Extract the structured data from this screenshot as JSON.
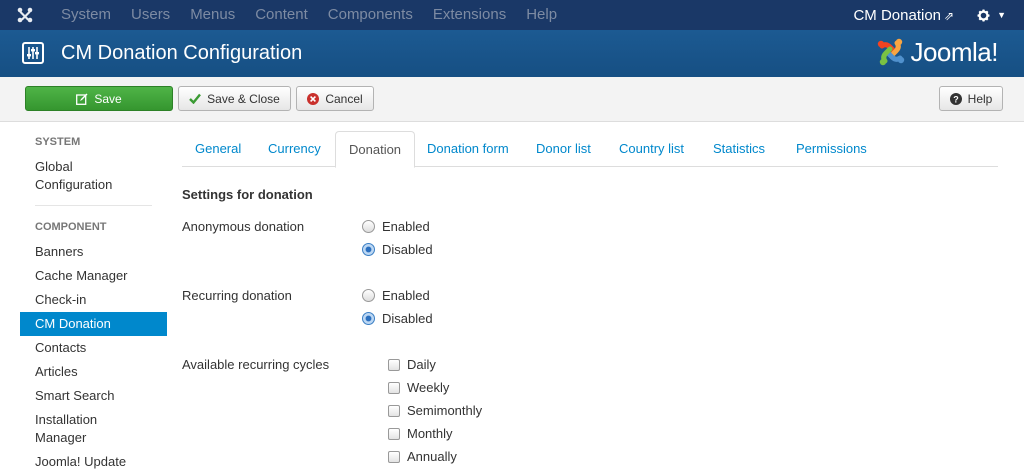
{
  "topnav": {
    "menu": [
      "System",
      "Users",
      "Menus",
      "Content",
      "Components",
      "Extensions",
      "Help"
    ],
    "site_link": "CM Donation"
  },
  "header": {
    "title": "CM Donation Configuration",
    "brand": "Joomla!"
  },
  "toolbar": {
    "save_label": "Save",
    "save_close_label": "Save & Close",
    "cancel_label": "Cancel",
    "help_label": "Help"
  },
  "sidebar": {
    "system_heading": "SYSTEM",
    "system_items": [
      "Global Configuration"
    ],
    "component_heading": "COMPONENT",
    "component_items": [
      "Banners",
      "Cache Manager",
      "Check-in",
      "CM Donation",
      "Contacts",
      "Articles",
      "Smart Search",
      "Installation Manager",
      "Joomla! Update"
    ],
    "active_item": "CM Donation"
  },
  "tabs": [
    "General",
    "Currency",
    "Donation",
    "Donation form",
    "Donor list",
    "Country list",
    "Statistics",
    "Permissions"
  ],
  "active_tab": "Donation",
  "form": {
    "title": "Settings for donation",
    "anonymous": {
      "label": "Anonymous donation",
      "options": [
        "Enabled",
        "Disabled"
      ],
      "selected": "Disabled"
    },
    "recurring": {
      "label": "Recurring donation",
      "options": [
        "Enabled",
        "Disabled"
      ],
      "selected": "Disabled"
    },
    "cycles": {
      "label": "Available recurring cycles",
      "options": [
        "Daily",
        "Weekly",
        "Semimonthly",
        "Monthly",
        "Annually"
      ],
      "checked": []
    }
  },
  "colors": {
    "nav_bg": "#1a3867",
    "header_bg": "#17568c",
    "save_green": "#3da539",
    "active_blue": "#0088cc",
    "link_blue": "#0088cc"
  }
}
